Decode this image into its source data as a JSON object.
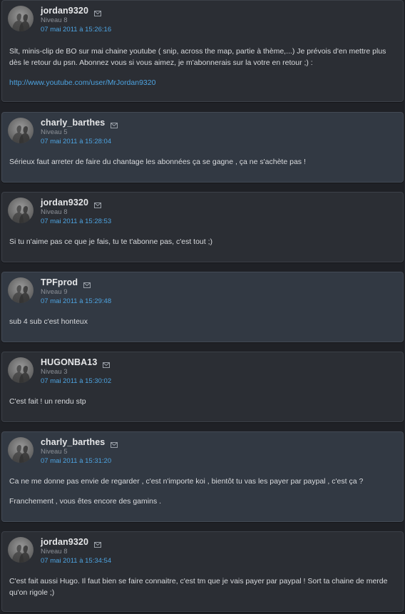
{
  "posts": [
    {
      "username": "jordan9320",
      "level": "Niveau 8",
      "date": "07 mai 2011 à 15:26:16",
      "paragraphs": [
        "Slt, minis-clip de BO sur mai chaine youtube ( snip, across the map, partie à thème,...) Je prévois d'en mettre plus dès le retour du psn. Abonnez vous si vous aimez, je m'abonnerais sur la votre en retour ;) :"
      ],
      "link": "http://www.youtube.com/user/MrJordan9320"
    },
    {
      "username": "charly_barthes",
      "level": "Niveau 5",
      "date": "07 mai 2011 à 15:28:04",
      "paragraphs": [
        "Sérieux faut arreter de faire du chantage les abonnées ça se gagne , ça ne s'achète pas !"
      ]
    },
    {
      "username": "jordan9320",
      "level": "Niveau 8",
      "date": "07 mai 2011 à 15:28:53",
      "paragraphs": [
        "Si tu n'aime pas ce que je fais, tu te t'abonne pas, c'est tout ;)"
      ]
    },
    {
      "username": "TPFprod",
      "level": "Niveau 9",
      "date": "07 mai 2011 à 15:29:48",
      "paragraphs": [
        "sub 4 sub c'est honteux"
      ]
    },
    {
      "username": "HUGONBA13",
      "level": "Niveau 3",
      "date": "07 mai 2011 à 15:30:02",
      "paragraphs": [
        "C'est fait ! un rendu stp"
      ]
    },
    {
      "username": "charly_barthes",
      "level": "Niveau 5",
      "date": "07 mai 2011 à 15:31:20",
      "paragraphs": [
        "Ca ne me donne pas envie de regarder , c'est n'importe koi , bientôt tu vas les payer par paypal , c'est ça ?",
        "Franchement , vous êtes encore des gamins ."
      ]
    },
    {
      "username": "jordan9320",
      "level": "Niveau 8",
      "date": "07 mai 2011 à 15:34:54",
      "paragraphs": [
        "C'est fait aussi Hugo. Il faut bien se faire connaitre, c'est tm que je vais payer par paypal ! Sort ta chaine de merde qu'on rigole ;)"
      ]
    }
  ]
}
